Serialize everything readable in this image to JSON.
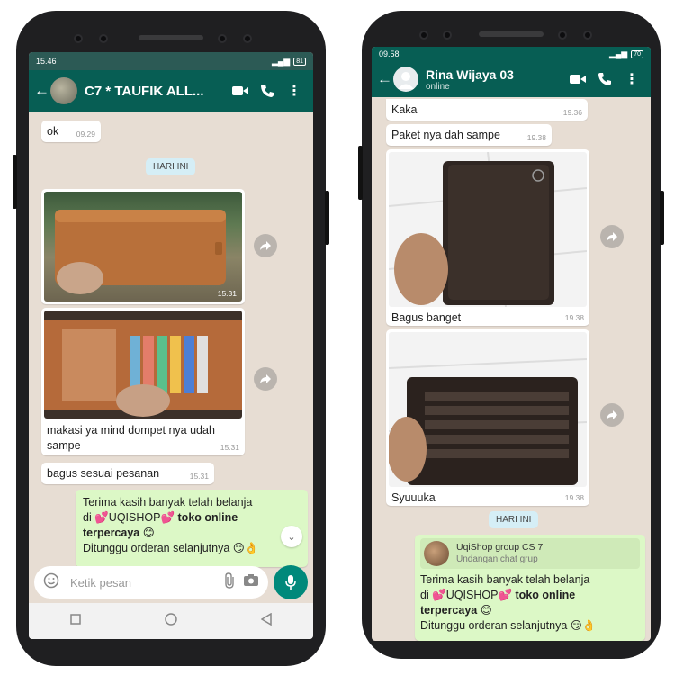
{
  "left": {
    "status_time": "15.46",
    "status_battery": "81",
    "contact_name": "C7 * TAUFIK ALL...",
    "messages": {
      "ok_text": "ok",
      "ok_time": "09.29",
      "day_chip": "HARI INI",
      "photo1_time": "15.31",
      "photo2_caption": "makasi ya mind dompet nya udah sampe",
      "photo2_time": "15.31",
      "bagus_text": "bagus sesuai pesanan",
      "bagus_time": "15.31",
      "outgoing_line1": "Terima kasih banyak telah belanja",
      "outgoing_di": "di",
      "outgoing_shop": "UQISHOP",
      "outgoing_bold": "toko online",
      "outgoing_bold2": "terpercaya",
      "outgoing_line3": "Ditunggu orderan selanjutnya"
    },
    "composer_placeholder": "Ketik pesan"
  },
  "right": {
    "status_time": "09.58",
    "status_battery": "70",
    "contact_name": "Rina Wijaya 03",
    "contact_status": "online",
    "messages": {
      "kaka_text": "Kaka",
      "kaka_time": "19.36",
      "paket_text": "Paket nya dah sampe",
      "paket_time": "19.38",
      "photo1_caption": "Bagus banget",
      "photo1_time": "19.38",
      "photo2_caption": "Syuuuka",
      "photo2_time": "19.38",
      "day_chip": "HARI INI",
      "quote_name": "UqiShop group CS 7",
      "quote_sub": "Undangan chat grup",
      "outgoing_line1": "Terima kasih banyak telah belanja",
      "outgoing_di": "di",
      "outgoing_shop": "UQISHOP",
      "outgoing_bold": "toko online",
      "outgoing_bold2": "terpercaya",
      "outgoing_line3": "Ditunggu orderan selanjutnya"
    }
  },
  "colors": {
    "header": "#075e54",
    "chat_bg": "#e7ddd3",
    "outgoing": "#dcf8c6",
    "mic": "#00897b"
  }
}
